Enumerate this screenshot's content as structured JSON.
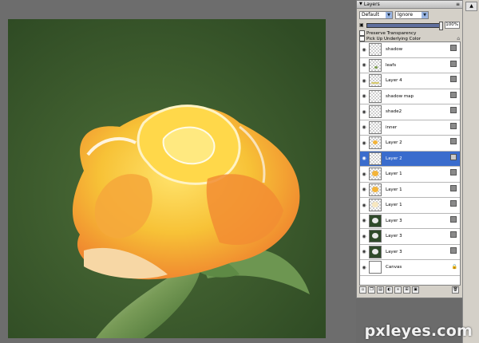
{
  "panel": {
    "title": "Layers",
    "menu": "≡",
    "blend_mode": "Default",
    "opacity_mode": "Ignore",
    "opacity_value": "100%",
    "preserve_transparency": "Preserve Transparency",
    "pick_up_underlying_color": "Pick Up Underlying Color"
  },
  "layers": [
    {
      "name": "shadow"
    },
    {
      "name": "leafs"
    },
    {
      "name": "Layer 4"
    },
    {
      "name": "shadow map"
    },
    {
      "name": "shade2"
    },
    {
      "name": "inner"
    },
    {
      "name": "Layer 2"
    },
    {
      "name": "Layer 2"
    },
    {
      "name": "Layer 1"
    },
    {
      "name": "Layer 1"
    },
    {
      "name": "Layer 1"
    },
    {
      "name": "Layer 3"
    },
    {
      "name": "Layer 3"
    },
    {
      "name": "Layer 3"
    },
    {
      "name": "Canvas"
    }
  ],
  "watermark": "pxleyes.com",
  "colors": {
    "selected_row": "#3a6ccd",
    "canvas_bg": "#3b5a2c",
    "rose_yellow": "#f6c93c",
    "rose_orange": "#f29a3a"
  }
}
